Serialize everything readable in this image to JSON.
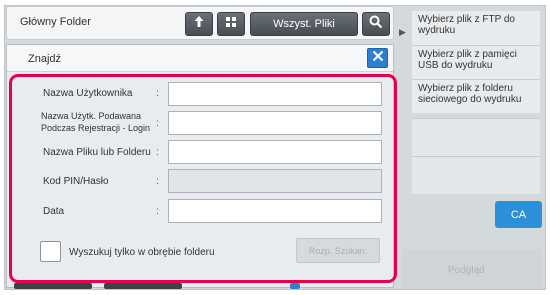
{
  "topbar": {
    "folder_title": "Główny Folder",
    "all_files_label": "Wszyst. Pliki",
    "icons": [
      "up-arrow-icon",
      "grid-icon",
      "search-icon"
    ]
  },
  "dialog": {
    "title": "Znajdź",
    "close_icon": "close-icon",
    "fields": [
      {
        "label": "Nazwa Użytkownika",
        "colon": ":",
        "value": ""
      },
      {
        "label": "Nazwa Użytk. Podawana Podczas Rejestracji - Login",
        "colon": ":",
        "value": ""
      },
      {
        "label": "Nazwa Pliku lub Folderu",
        "colon": ":",
        "value": ""
      },
      {
        "label": "Kod PIN/Hasło",
        "colon": ":",
        "value": ""
      },
      {
        "label": "Data",
        "colon": ":",
        "value": ""
      }
    ],
    "checkbox_label": "Wyszukuj tylko w obrębie folderu",
    "search_button": "Rozp. Szukan."
  },
  "side_panel": {
    "items": [
      "Wybierz plik z FTP do wydruku",
      "Wybierz plik z pamięci USB do wydruku",
      "Wybierz plik z folderu sieciowego do wydruku"
    ],
    "ca_button": "CA",
    "bottom_action": "Podgląd"
  },
  "colors": {
    "accent_blue": "#2d7fcf",
    "highlight_red": "#e5004f",
    "ca_blue": "#2d8fd7"
  }
}
